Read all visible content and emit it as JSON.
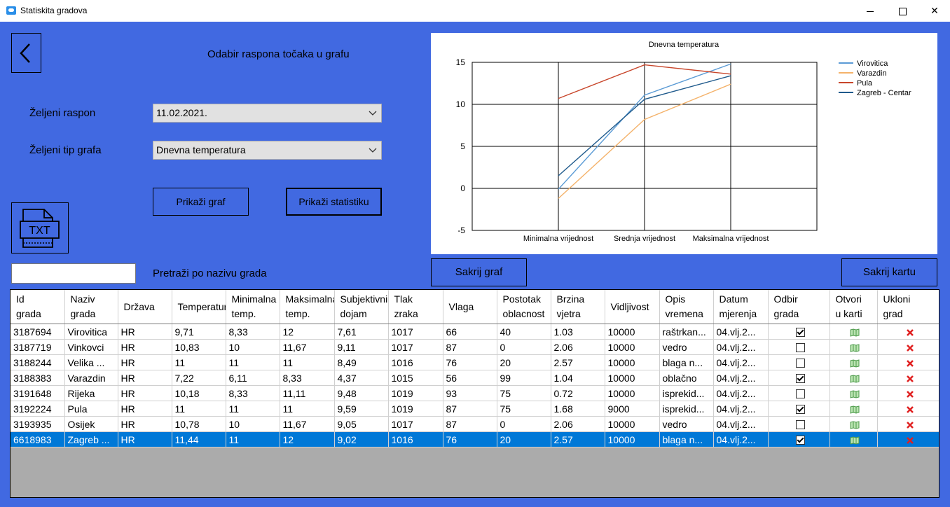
{
  "window": {
    "title": "Statiskita gradova",
    "min_label": "",
    "close_label": "✕"
  },
  "header": {
    "range_title": "Odabir raspona točaka u grafu"
  },
  "form": {
    "range_label": "Željeni raspon",
    "range_value": "11.02.2021.",
    "type_label": "Željeni tip grafa",
    "type_value": "Dnevna temperatura",
    "show_graph_label": "Prikaži graf",
    "show_stats_label": "Prikaži statistiku",
    "search_label": "Pretraži po nazivu grada",
    "search_value": "",
    "hide_graph_label": "Sakrij graf",
    "hide_map_label": "Sakrij kartu",
    "txt_label": "TXT"
  },
  "chart_data": {
    "type": "line",
    "title": "Dnevna temperatura",
    "categories": [
      "Minimalna vrijednost",
      "Srednja vrijednost",
      "Maksimalna vrijednost"
    ],
    "ylim": [
      -5,
      15
    ],
    "yticks": [
      "15",
      "10",
      "5",
      "0",
      "-5"
    ],
    "grid": true,
    "legend_position": "top-right",
    "series": [
      {
        "name": "Virovitica",
        "color": "#5b9bd5",
        "values": [
          -0.1,
          11.1,
          14.8
        ]
      },
      {
        "name": "Varazdin",
        "color": "#f4b26a",
        "values": [
          -1.2,
          8.2,
          12.4
        ]
      },
      {
        "name": "Pula",
        "color": "#c8462b",
        "values": [
          10.7,
          14.7,
          13.6
        ]
      },
      {
        "name": "Zagreb - Centar",
        "color": "#1f5a8c",
        "values": [
          1.5,
          10.6,
          13.4
        ]
      }
    ]
  },
  "table": {
    "columns": [
      [
        "Id",
        "grada"
      ],
      [
        "Naziv",
        "grada"
      ],
      [
        "Država"
      ],
      [
        "Temperatura"
      ],
      [
        "Minimalna",
        "temp."
      ],
      [
        "Maksimalna",
        "temp."
      ],
      [
        "Subjektivni",
        "dojam"
      ],
      [
        "Tlak",
        "zraka"
      ],
      [
        "Vlaga"
      ],
      [
        "Postotak",
        "oblacnost"
      ],
      [
        "Brzina",
        "vjetra"
      ],
      [
        "Vidljivost"
      ],
      [
        "Opis",
        "vremena"
      ],
      [
        "Datum",
        "mjerenja"
      ],
      [
        "Odbir",
        "grada"
      ],
      [
        "Otvori",
        "u karti"
      ],
      [
        "Ukloni",
        "grad"
      ]
    ],
    "rows": [
      {
        "cells": [
          "3187694",
          "Virovitica",
          "HR",
          "9,71",
          "8,33",
          "12",
          "7,61",
          "1017",
          "66",
          "40",
          "1.03",
          "10000",
          "raštrkan...",
          "04.vlj.2..."
        ],
        "checked": true,
        "selected": false
      },
      {
        "cells": [
          "3187719",
          "Vinkovci",
          "HR",
          "10,83",
          "10",
          "11,67",
          "9,11",
          "1017",
          "87",
          "0",
          "2.06",
          "10000",
          "vedro",
          "04.vlj.2..."
        ],
        "checked": false,
        "selected": false
      },
      {
        "cells": [
          "3188244",
          "Velika ...",
          "HR",
          "11",
          "11",
          "11",
          "8,49",
          "1016",
          "76",
          "20",
          "2.57",
          "10000",
          "blaga n...",
          "04.vlj.2..."
        ],
        "checked": false,
        "selected": false
      },
      {
        "cells": [
          "3188383",
          "Varazdin",
          "HR",
          "7,22",
          "6,11",
          "8,33",
          "4,37",
          "1015",
          "56",
          "99",
          "1.04",
          "10000",
          "oblačno",
          "04.vlj.2..."
        ],
        "checked": true,
        "selected": false
      },
      {
        "cells": [
          "3191648",
          "Rijeka",
          "HR",
          "10,18",
          "8,33",
          "11,11",
          "9,48",
          "1019",
          "93",
          "75",
          "0.72",
          "10000",
          "isprekid...",
          "04.vlj.2..."
        ],
        "checked": false,
        "selected": false
      },
      {
        "cells": [
          "3192224",
          "Pula",
          "HR",
          "11",
          "11",
          "11",
          "9,59",
          "1019",
          "87",
          "75",
          "1.68",
          "9000",
          "isprekid...",
          "04.vlj.2..."
        ],
        "checked": true,
        "selected": false
      },
      {
        "cells": [
          "3193935",
          "Osijek",
          "HR",
          "10,78",
          "10",
          "11,67",
          "9,05",
          "1017",
          "87",
          "0",
          "2.06",
          "10000",
          "vedro",
          "04.vlj.2..."
        ],
        "checked": false,
        "selected": false
      },
      {
        "cells": [
          "6618983",
          "Zagreb ...",
          "HR",
          "11,44",
          "11",
          "12",
          "9,02",
          "1016",
          "76",
          "20",
          "2.57",
          "10000",
          "blaga n...",
          "04.vlj.2..."
        ],
        "checked": true,
        "selected": true
      }
    ]
  }
}
